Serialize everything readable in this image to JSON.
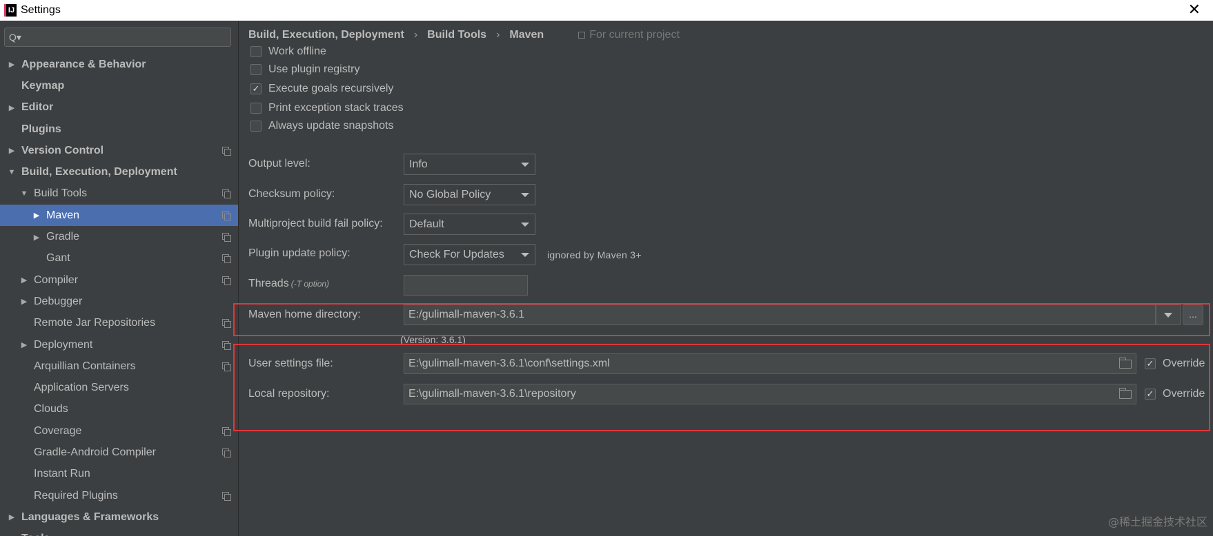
{
  "window": {
    "title": "Settings",
    "app_icon": "IJ",
    "close_glyph": "✕"
  },
  "search": {
    "icon": "Q▾",
    "placeholder": ""
  },
  "tree": [
    {
      "label": "Appearance & Behavior",
      "arrow": "▶",
      "indent": 0,
      "bold": true,
      "copy": false
    },
    {
      "label": "Keymap",
      "arrow": "",
      "indent": 0,
      "bold": true,
      "copy": false
    },
    {
      "label": "Editor",
      "arrow": "▶",
      "indent": 0,
      "bold": true,
      "copy": false
    },
    {
      "label": "Plugins",
      "arrow": "",
      "indent": 0,
      "bold": true,
      "copy": false
    },
    {
      "label": "Version Control",
      "arrow": "▶",
      "indent": 0,
      "bold": true,
      "copy": true
    },
    {
      "label": "Build, Execution, Deployment",
      "arrow": "▼",
      "indent": 0,
      "bold": true,
      "copy": false
    },
    {
      "label": "Build Tools",
      "arrow": "▼",
      "indent": 1,
      "bold": false,
      "copy": true
    },
    {
      "label": "Maven",
      "arrow": "▶",
      "indent": 2,
      "bold": false,
      "copy": true,
      "selected": true
    },
    {
      "label": "Gradle",
      "arrow": "▶",
      "indent": 2,
      "bold": false,
      "copy": true
    },
    {
      "label": "Gant",
      "arrow": "",
      "indent": 2,
      "bold": false,
      "copy": true
    },
    {
      "label": "Compiler",
      "arrow": "▶",
      "indent": 1,
      "bold": false,
      "copy": true
    },
    {
      "label": "Debugger",
      "arrow": "▶",
      "indent": 1,
      "bold": false,
      "copy": false
    },
    {
      "label": "Remote Jar Repositories",
      "arrow": "",
      "indent": 1,
      "bold": false,
      "copy": true
    },
    {
      "label": "Deployment",
      "arrow": "▶",
      "indent": 1,
      "bold": false,
      "copy": true
    },
    {
      "label": "Arquillian Containers",
      "arrow": "",
      "indent": 1,
      "bold": false,
      "copy": true
    },
    {
      "label": "Application Servers",
      "arrow": "",
      "indent": 1,
      "bold": false,
      "copy": false
    },
    {
      "label": "Clouds",
      "arrow": "",
      "indent": 1,
      "bold": false,
      "copy": false
    },
    {
      "label": "Coverage",
      "arrow": "",
      "indent": 1,
      "bold": false,
      "copy": true
    },
    {
      "label": "Gradle-Android Compiler",
      "arrow": "",
      "indent": 1,
      "bold": false,
      "copy": true
    },
    {
      "label": "Instant Run",
      "arrow": "",
      "indent": 1,
      "bold": false,
      "copy": false
    },
    {
      "label": "Required Plugins",
      "arrow": "",
      "indent": 1,
      "bold": false,
      "copy": true
    },
    {
      "label": "Languages & Frameworks",
      "arrow": "▶",
      "indent": 0,
      "bold": true,
      "copy": false
    },
    {
      "label": "Tools",
      "arrow": "▶",
      "indent": 0,
      "bold": true,
      "copy": false
    }
  ],
  "breadcrumb": {
    "items": [
      "Build, Execution, Deployment",
      "Build Tools",
      "Maven"
    ],
    "separator": "›",
    "scope": "For current project"
  },
  "checkboxes": [
    {
      "label": "Work offline",
      "checked": false
    },
    {
      "label": "Use plugin registry",
      "checked": false
    },
    {
      "label": "Execute goals recursively",
      "checked": true
    },
    {
      "label": "Print exception stack traces",
      "checked": false
    },
    {
      "label": "Always update snapshots",
      "checked": false
    }
  ],
  "output_level": {
    "label": "Output level:",
    "value": "Info"
  },
  "checksum_policy": {
    "label": "Checksum policy:",
    "value": "No Global Policy"
  },
  "multiproject_policy": {
    "label": "Multiproject build fail policy:",
    "value": "Default"
  },
  "plugin_update_policy": {
    "label": "Plugin update policy:",
    "value": "Check For Updates",
    "note": "ignored by Maven 3+"
  },
  "threads": {
    "label": "Threads",
    "hint": "(-T option)",
    "value": ""
  },
  "maven_home": {
    "label": "Maven home directory:",
    "value": "E:/gulimall-maven-3.6.1",
    "button": "...",
    "version": "(Version: 3.6.1)"
  },
  "user_settings": {
    "label": "User settings file:",
    "value": "E:\\gulimall-maven-3.6.1\\conf\\settings.xml",
    "override_label": "Override",
    "override_checked": true
  },
  "local_repo": {
    "label": "Local repository:",
    "value": "E:\\gulimall-maven-3.6.1\\repository",
    "override_label": "Override",
    "override_checked": true
  },
  "watermark": "@稀土掘金技术社区",
  "colors": {
    "background": "#3c3f41",
    "selection": "#4b6eaf",
    "highlight_box": "#e0373b"
  }
}
